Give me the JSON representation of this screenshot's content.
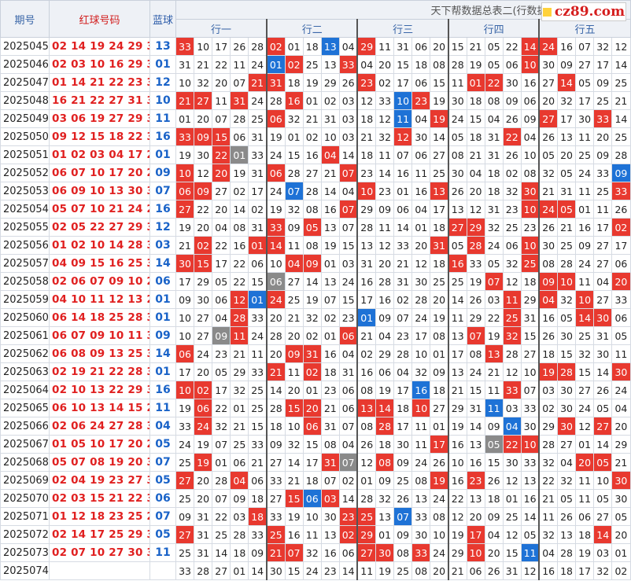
{
  "header": {
    "issue_label": "期号",
    "red_label": "红球号码",
    "blue_label": "蓝球",
    "table_title": "天下帮数据总表二(行数据)",
    "groups": [
      "行一",
      "行二",
      "行三",
      "行四",
      "行五"
    ],
    "logo_text": "cz89.com"
  },
  "colors": {
    "hit_red": "#e8392f",
    "hit_blue": "#1e72d6",
    "hit_gray": "#8a8a8a",
    "red_text": "#e02020",
    "blue_text": "#1a63c8"
  },
  "rows": [
    {
      "issue": "2025045",
      "red": "02 14 19 24 29 33",
      "blue": "13",
      "cells": [
        "33",
        "10",
        "17",
        "26",
        "28",
        "02",
        "01",
        "18",
        "13",
        "04",
        "29",
        "11",
        "31",
        "06",
        "20",
        "15",
        "21",
        "05",
        "22",
        "14",
        "24",
        "16",
        "07",
        "32",
        "12"
      ],
      "hits": {
        "0": "r",
        "5": "r",
        "8": "b",
        "10": "r",
        "19": "r",
        "20": "r"
      }
    },
    {
      "issue": "2025046",
      "red": "02 03 10 16 29 33",
      "blue": "01",
      "cells": [
        "31",
        "21",
        "22",
        "11",
        "24",
        "01",
        "02",
        "25",
        "13",
        "33",
        "04",
        "20",
        "15",
        "18",
        "08",
        "28",
        "19",
        "05",
        "06",
        "10",
        "30",
        "09",
        "27",
        "17",
        "14"
      ],
      "hits": {
        "5": "b",
        "6": "r",
        "9": "r",
        "19": "r"
      }
    },
    {
      "issue": "2025047",
      "red": "01 14 21 22 23 31",
      "blue": "12",
      "cells": [
        "10",
        "32",
        "20",
        "07",
        "21",
        "31",
        "18",
        "19",
        "29",
        "26",
        "23",
        "02",
        "17",
        "06",
        "15",
        "11",
        "01",
        "22",
        "30",
        "16",
        "27",
        "14",
        "05",
        "09",
        "25"
      ],
      "hits": {
        "4": "r",
        "5": "r",
        "10": "r",
        "16": "r",
        "17": "r",
        "21": "r"
      }
    },
    {
      "issue": "2025048",
      "red": "16 21 22 27 31 33",
      "blue": "10",
      "cells": [
        "21",
        "27",
        "11",
        "31",
        "24",
        "28",
        "16",
        "01",
        "02",
        "03",
        "12",
        "33",
        "10",
        "23",
        "19",
        "30",
        "18",
        "08",
        "09",
        "06",
        "20",
        "32",
        "17",
        "25",
        "21"
      ],
      "hits": {
        "0": "r",
        "1": "r",
        "3": "r",
        "6": "r",
        "12": "b",
        "13": "r"
      }
    },
    {
      "issue": "2025049",
      "red": "03 06 19 27 29 33",
      "blue": "11",
      "cells": [
        "01",
        "20",
        "07",
        "28",
        "25",
        "06",
        "32",
        "21",
        "31",
        "03",
        "18",
        "12",
        "11",
        "04",
        "19",
        "24",
        "15",
        "04",
        "26",
        "09",
        "27",
        "17",
        "30",
        "33",
        "14"
      ],
      "hits": {
        "5": "r",
        "12": "b",
        "14": "r",
        "20": "r",
        "23": "r"
      }
    },
    {
      "issue": "2025050",
      "red": "09 12 15 18 22 33",
      "blue": "16",
      "cells": [
        "33",
        "09",
        "15",
        "06",
        "31",
        "19",
        "01",
        "02",
        "10",
        "03",
        "21",
        "32",
        "12",
        "30",
        "14",
        "05",
        "18",
        "31",
        "22",
        "04",
        "26",
        "13",
        "11",
        "20",
        "25"
      ],
      "hits": {
        "0": "r",
        "1": "r",
        "2": "r",
        "12": "r",
        "18": "r"
      }
    },
    {
      "issue": "2025051",
      "red": "01 02 03 04 17 22",
      "blue": "01",
      "cells": [
        "19",
        "30",
        "22",
        "01",
        "33",
        "24",
        "15",
        "16",
        "04",
        "14",
        "18",
        "11",
        "07",
        "06",
        "27",
        "08",
        "21",
        "31",
        "26",
        "10",
        "05",
        "20",
        "25",
        "09",
        "28"
      ],
      "hits": {
        "2": "r",
        "3": "g",
        "8": "r"
      }
    },
    {
      "issue": "2025052",
      "red": "06 07 10 17 20 26",
      "blue": "09",
      "cells": [
        "10",
        "12",
        "20",
        "19",
        "31",
        "06",
        "28",
        "27",
        "21",
        "07",
        "23",
        "14",
        "16",
        "11",
        "25",
        "30",
        "04",
        "18",
        "02",
        "08",
        "32",
        "05",
        "24",
        "33",
        "09"
      ],
      "hits": {
        "0": "r",
        "2": "r",
        "5": "r",
        "9": "r",
        "24": "b"
      }
    },
    {
      "issue": "2025053",
      "red": "06 09 10 13 30 33",
      "blue": "07",
      "cells": [
        "06",
        "09",
        "27",
        "02",
        "17",
        "24",
        "07",
        "28",
        "14",
        "04",
        "10",
        "23",
        "01",
        "16",
        "13",
        "26",
        "20",
        "18",
        "32",
        "30",
        "21",
        "31",
        "11",
        "25",
        "33"
      ],
      "hits": {
        "0": "r",
        "1": "r",
        "6": "b",
        "10": "r",
        "14": "r",
        "19": "r",
        "24": "r"
      }
    },
    {
      "issue": "2025054",
      "red": "05 07 10 21 24 27",
      "blue": "16",
      "cells": [
        "27",
        "22",
        "20",
        "14",
        "02",
        "19",
        "32",
        "08",
        "16",
        "07",
        "29",
        "09",
        "06",
        "04",
        "17",
        "13",
        "12",
        "31",
        "23",
        "10",
        "24",
        "05",
        "01",
        "11",
        "26"
      ],
      "hits": {
        "0": "r",
        "9": "r",
        "19": "r",
        "20": "r",
        "21": "r"
      }
    },
    {
      "issue": "2025055",
      "red": "02 05 22 27 29 33",
      "blue": "12",
      "cells": [
        "19",
        "20",
        "04",
        "08",
        "31",
        "33",
        "09",
        "05",
        "13",
        "07",
        "28",
        "11",
        "14",
        "01",
        "18",
        "27",
        "29",
        "32",
        "25",
        "23",
        "26",
        "21",
        "16",
        "17",
        "02"
      ],
      "hits": {
        "5": "r",
        "7": "r",
        "15": "r",
        "16": "r",
        "24": "r"
      }
    },
    {
      "issue": "2025056",
      "red": "01 02 10 14 28 31",
      "blue": "03",
      "cells": [
        "21",
        "02",
        "22",
        "16",
        "01",
        "14",
        "11",
        "08",
        "19",
        "15",
        "13",
        "12",
        "33",
        "20",
        "31",
        "05",
        "28",
        "24",
        "06",
        "10",
        "30",
        "25",
        "09",
        "27",
        "17"
      ],
      "hits": {
        "1": "r",
        "4": "r",
        "5": "r",
        "14": "r",
        "16": "r",
        "19": "r"
      }
    },
    {
      "issue": "2025057",
      "red": "04 09 15 16 25 30",
      "blue": "14",
      "cells": [
        "30",
        "15",
        "17",
        "22",
        "06",
        "10",
        "04",
        "09",
        "01",
        "03",
        "31",
        "20",
        "21",
        "12",
        "18",
        "16",
        "33",
        "05",
        "32",
        "25",
        "08",
        "28",
        "24",
        "27",
        "06"
      ],
      "hits": {
        "0": "r",
        "1": "r",
        "6": "r",
        "7": "r",
        "15": "r",
        "19": "r"
      }
    },
    {
      "issue": "2025058",
      "red": "02 06 07 09 10 20",
      "blue": "06",
      "cells": [
        "17",
        "29",
        "05",
        "22",
        "15",
        "06",
        "27",
        "14",
        "13",
        "24",
        "16",
        "28",
        "31",
        "30",
        "25",
        "25",
        "19",
        "07",
        "12",
        "18",
        "09",
        "10",
        "11",
        "04",
        "20"
      ],
      "hits": {
        "5": "g",
        "17": "r",
        "20": "r",
        "21": "r",
        "24": "r"
      }
    },
    {
      "issue": "2025059",
      "red": "04 10 11 12 13 24",
      "blue": "01",
      "cells": [
        "09",
        "30",
        "06",
        "12",
        "01",
        "24",
        "25",
        "19",
        "07",
        "15",
        "17",
        "16",
        "02",
        "28",
        "20",
        "14",
        "26",
        "03",
        "11",
        "29",
        "04",
        "32",
        "10",
        "27",
        "33"
      ],
      "hits": {
        "3": "r",
        "4": "b",
        "5": "r",
        "18": "r",
        "20": "r",
        "22": "r"
      }
    },
    {
      "issue": "2025060",
      "red": "06 14 18 25 28 30",
      "blue": "01",
      "cells": [
        "10",
        "27",
        "04",
        "28",
        "33",
        "20",
        "21",
        "32",
        "02",
        "23",
        "01",
        "09",
        "07",
        "24",
        "19",
        "11",
        "29",
        "22",
        "25",
        "31",
        "16",
        "05",
        "14",
        "30",
        "06"
      ],
      "hits": {
        "3": "r",
        "10": "b",
        "18": "r",
        "22": "r",
        "23": "r"
      }
    },
    {
      "issue": "2025061",
      "red": "06 07 09 10 11 32",
      "blue": "09",
      "cells": [
        "10",
        "27",
        "09",
        "11",
        "24",
        "28",
        "20",
        "02",
        "01",
        "06",
        "21",
        "04",
        "23",
        "17",
        "08",
        "13",
        "07",
        "19",
        "32",
        "15",
        "26",
        "30",
        "25",
        "31",
        "05"
      ],
      "hits": {
        "2": "g",
        "3": "r",
        "9": "r",
        "16": "r",
        "18": "r"
      }
    },
    {
      "issue": "2025062",
      "red": "06 08 09 13 25 31",
      "blue": "14",
      "cells": [
        "06",
        "24",
        "23",
        "21",
        "11",
        "20",
        "09",
        "31",
        "16",
        "04",
        "02",
        "29",
        "28",
        "10",
        "01",
        "17",
        "08",
        "13",
        "28",
        "27",
        "18",
        "15",
        "32",
        "30",
        "11"
      ],
      "hits": {
        "0": "r",
        "6": "r",
        "7": "r",
        "17": "r"
      }
    },
    {
      "issue": "2025063",
      "red": "02 19 21 22 28 30",
      "blue": "01",
      "cells": [
        "17",
        "20",
        "05",
        "29",
        "33",
        "21",
        "11",
        "02",
        "18",
        "31",
        "16",
        "06",
        "04",
        "32",
        "09",
        "13",
        "24",
        "21",
        "12",
        "10",
        "19",
        "28",
        "15",
        "14",
        "30"
      ],
      "hits": {
        "5": "r",
        "7": "r",
        "20": "r",
        "21": "r",
        "24": "r"
      }
    },
    {
      "issue": "2025064",
      "red": "02 10 13 22 29 33",
      "blue": "16",
      "cells": [
        "10",
        "02",
        "17",
        "32",
        "25",
        "14",
        "20",
        "01",
        "23",
        "06",
        "08",
        "19",
        "17",
        "16",
        "18",
        "21",
        "15",
        "11",
        "33",
        "07",
        "03",
        "30",
        "27",
        "26",
        "24"
      ],
      "hits": {
        "0": "r",
        "1": "r",
        "13": "b",
        "18": "r"
      }
    },
    {
      "issue": "2025065",
      "red": "06 10 13 14 15 20",
      "blue": "11",
      "cells": [
        "19",
        "06",
        "22",
        "01",
        "25",
        "28",
        "15",
        "20",
        "21",
        "06",
        "13",
        "14",
        "18",
        "10",
        "27",
        "29",
        "31",
        "11",
        "03",
        "33",
        "02",
        "30",
        "24",
        "05",
        "04"
      ],
      "hits": {
        "1": "r",
        "6": "r",
        "7": "r",
        "10": "r",
        "11": "r",
        "13": "r",
        "17": "b"
      }
    },
    {
      "issue": "2025066",
      "red": "02 06 24 27 28 30",
      "blue": "04",
      "cells": [
        "33",
        "24",
        "32",
        "21",
        "15",
        "18",
        "10",
        "06",
        "31",
        "07",
        "08",
        "28",
        "17",
        "11",
        "01",
        "19",
        "14",
        "09",
        "04",
        "30",
        "29",
        "30",
        "12",
        "27",
        "20"
      ],
      "hits": {
        "1": "r",
        "7": "r",
        "11": "r",
        "18": "b",
        "21": "r",
        "23": "r"
      }
    },
    {
      "issue": "2025067",
      "red": "01 05 10 17 20 22",
      "blue": "05",
      "cells": [
        "24",
        "19",
        "07",
        "25",
        "33",
        "09",
        "32",
        "15",
        "08",
        "04",
        "26",
        "18",
        "30",
        "11",
        "17",
        "16",
        "13",
        "05",
        "22",
        "10",
        "28",
        "27",
        "01",
        "14",
        "29"
      ],
      "hits": {
        "14": "r",
        "17": "g",
        "18": "r",
        "19": "r"
      }
    },
    {
      "issue": "2025068",
      "red": "05 07 08 19 20 31",
      "blue": "07",
      "cells": [
        "25",
        "19",
        "01",
        "06",
        "21",
        "27",
        "14",
        "17",
        "31",
        "07",
        "12",
        "08",
        "09",
        "24",
        "26",
        "10",
        "16",
        "15",
        "30",
        "33",
        "32",
        "04",
        "20",
        "05",
        "21"
      ],
      "hits": {
        "1": "r",
        "8": "r",
        "9": "g",
        "11": "r",
        "22": "r",
        "23": "r"
      }
    },
    {
      "issue": "2025069",
      "red": "02 04 19 23 27 30",
      "blue": "05",
      "cells": [
        "27",
        "20",
        "28",
        "04",
        "06",
        "33",
        "21",
        "18",
        "07",
        "02",
        "01",
        "09",
        "25",
        "08",
        "19",
        "16",
        "23",
        "26",
        "12",
        "13",
        "22",
        "32",
        "11",
        "10",
        "30"
      ],
      "hits": {
        "0": "r",
        "3": "r",
        "14": "r",
        "16": "r",
        "24": "r"
      }
    },
    {
      "issue": "2025070",
      "red": "02 03 15 21 22 33",
      "blue": "06",
      "cells": [
        "25",
        "20",
        "07",
        "09",
        "18",
        "27",
        "15",
        "06",
        "03",
        "14",
        "28",
        "32",
        "26",
        "13",
        "24",
        "22",
        "13",
        "18",
        "01",
        "16",
        "21",
        "05",
        "11",
        "05",
        "30"
      ],
      "hits": {
        "6": "r",
        "7": "b",
        "8": "r"
      }
    },
    {
      "issue": "2025071",
      "red": "01 12 18 23 25 28",
      "blue": "07",
      "cells": [
        "09",
        "31",
        "22",
        "03",
        "18",
        "33",
        "19",
        "10",
        "30",
        "23",
        "25",
        "13",
        "07",
        "33",
        "08",
        "12",
        "20",
        "09",
        "25",
        "14",
        "11",
        "26",
        "06",
        "27",
        "05"
      ],
      "hits": {
        "4": "r",
        "9": "r",
        "10": "r",
        "12": "b"
      }
    },
    {
      "issue": "2025072",
      "red": "02 14 17 25 29 33",
      "blue": "05",
      "cells": [
        "27",
        "31",
        "25",
        "28",
        "33",
        "25",
        "16",
        "11",
        "13",
        "02",
        "29",
        "01",
        "09",
        "30",
        "10",
        "19",
        "17",
        "04",
        "12",
        "05",
        "32",
        "13",
        "18",
        "14",
        "20"
      ],
      "hits": {
        "0": "r",
        "5": "r",
        "9": "r",
        "10": "r",
        "16": "r",
        "23": "r"
      }
    },
    {
      "issue": "2025073",
      "red": "02 07 10 27 30 33",
      "blue": "11",
      "cells": [
        "25",
        "31",
        "14",
        "18",
        "09",
        "21",
        "07",
        "32",
        "16",
        "06",
        "27",
        "30",
        "08",
        "33",
        "24",
        "29",
        "10",
        "20",
        "15",
        "11",
        "04",
        "28",
        "19",
        "03",
        "01"
      ],
      "hits": {
        "5": "r",
        "6": "r",
        "10": "r",
        "11": "r",
        "13": "r",
        "16": "r",
        "19": "b"
      }
    },
    {
      "issue": "2025074",
      "red": "",
      "blue": "",
      "cells": [
        "33",
        "28",
        "27",
        "01",
        "14",
        "30",
        "15",
        "24",
        "23",
        "14",
        "11",
        "19",
        "25",
        "08",
        "20",
        "21",
        "06",
        "26",
        "31",
        "12",
        "16",
        "18",
        "17",
        "32",
        "02"
      ],
      "hits": {}
    }
  ]
}
